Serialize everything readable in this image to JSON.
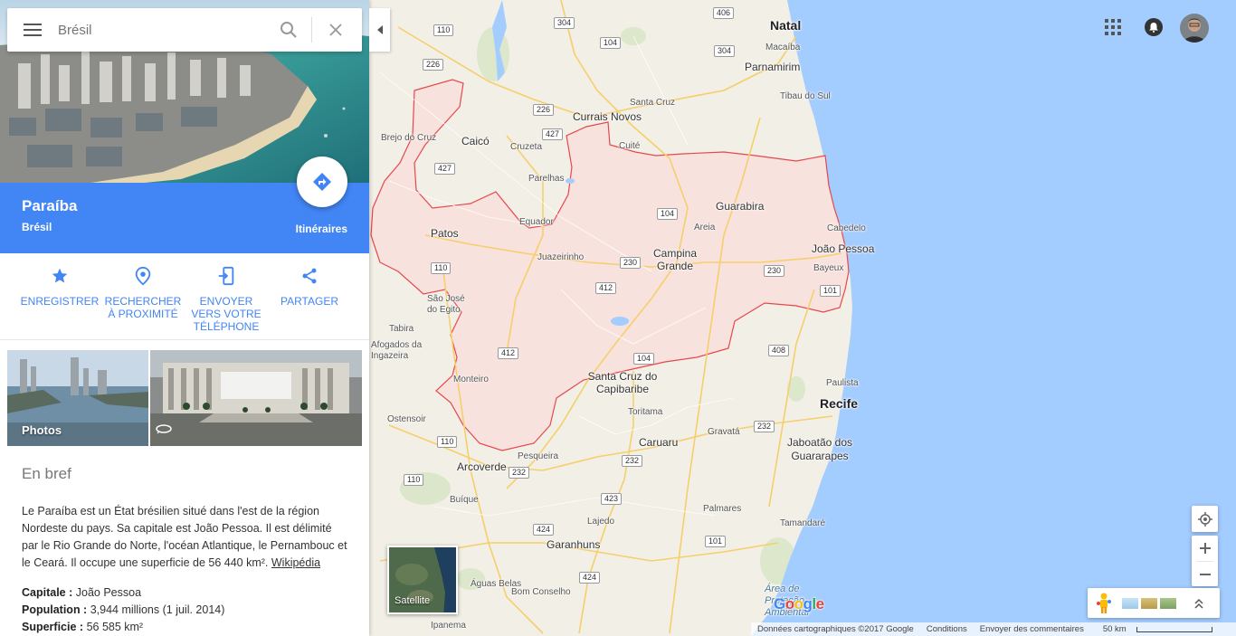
{
  "search": {
    "value": "Brésil",
    "placeholder": "Brésil"
  },
  "place": {
    "title": "Paraíba",
    "subtitle": "Brésil",
    "directions_label": "Itinéraires"
  },
  "actions": [
    {
      "label": "ENREGISTRER",
      "icon": "star-icon"
    },
    {
      "label": "RECHERCHER À PROXIMITÉ",
      "icon": "nearby-pin-icon"
    },
    {
      "label": "ENVOYER VERS VOTRE TÉLÉPHONE",
      "icon": "send-to-phone-icon"
    },
    {
      "label": "PARTAGER",
      "icon": "share-icon"
    }
  ],
  "photos": {
    "label": "Photos"
  },
  "overview": {
    "heading": "En bref",
    "text": "Le Paraíba est un État brésilien situé dans l'est de la région Nordeste du pays. Sa capitale est João Pessoa. Il est délimité par le Rio Grande do Norte, l'océan Atlantique, le Pernambouc et le Ceará. Il occupe une superficie de 56 440 km².",
    "link": "Wikipédia",
    "facts": [
      {
        "label": "Capitale :",
        "value": "João Pessoa"
      },
      {
        "label": "Population :",
        "value": "3,944 millions (1 juil. 2014)"
      },
      {
        "label": "Superficie :",
        "value": "56 585 km²"
      }
    ]
  },
  "map": {
    "cities": [
      {
        "name": "Natal",
        "size": "big"
      },
      {
        "name": "Macaíba",
        "size": "small"
      },
      {
        "name": "Parnamirim",
        "size": "med"
      },
      {
        "name": "Tibau do Sul",
        "size": "small"
      },
      {
        "name": "Santa Cruz",
        "size": "small"
      },
      {
        "name": "Currais Novos",
        "size": "med"
      },
      {
        "name": "Caicó",
        "size": "med"
      },
      {
        "name": "Cruzeta",
        "size": "small"
      },
      {
        "name": "Brejo do Cruz",
        "size": "small"
      },
      {
        "name": "Cuité",
        "size": "small"
      },
      {
        "name": "Parelhas",
        "size": "small"
      },
      {
        "name": "Guarabira",
        "size": "med"
      },
      {
        "name": "Cabedelo",
        "size": "small"
      },
      {
        "name": "João Pessoa",
        "size": "med"
      },
      {
        "name": "Bayeux",
        "size": "small"
      },
      {
        "name": "Equador",
        "size": "small"
      },
      {
        "name": "Areia",
        "size": "small"
      },
      {
        "name": "Patos",
        "size": "med"
      },
      {
        "name": "Juazeirinho",
        "size": "small"
      },
      {
        "name": "Campina Grande",
        "size": "med"
      },
      {
        "name": "São José do Egito",
        "size": "small"
      },
      {
        "name": "Tabira",
        "size": "small"
      },
      {
        "name": "Afogados da Ingazeira",
        "size": "small"
      },
      {
        "name": "Monteiro",
        "size": "small"
      },
      {
        "name": "Santa Cruz do Capibaribe",
        "size": "med"
      },
      {
        "name": "Paulista",
        "size": "small"
      },
      {
        "name": "Recife",
        "size": "big"
      },
      {
        "name": "Ostensoir",
        "size": "small"
      },
      {
        "name": "Toritama",
        "size": "small"
      },
      {
        "name": "Caruaru",
        "size": "med"
      },
      {
        "name": "Gravatá",
        "size": "small"
      },
      {
        "name": "Jaboatão dos Guararapes",
        "size": "med"
      },
      {
        "name": "Arcoverde",
        "size": "med"
      },
      {
        "name": "Pesqueira",
        "size": "small"
      },
      {
        "name": "Buíque",
        "size": "small"
      },
      {
        "name": "Palmares",
        "size": "small"
      },
      {
        "name": "Lajedo",
        "size": "small"
      },
      {
        "name": "Tamandaré",
        "size": "small"
      },
      {
        "name": "Garanhuns",
        "size": "med"
      },
      {
        "name": "Bom Conselho",
        "size": "small"
      },
      {
        "name": "Águas Belas",
        "size": "small"
      },
      {
        "name": "Ipanema",
        "size": "small"
      },
      {
        "name": "Área de Proteção Ambiental",
        "size": "blue"
      }
    ],
    "highways": [
      "304",
      "406",
      "110",
      "104",
      "304",
      "226",
      "226",
      "427",
      "427",
      "104",
      "230",
      "230",
      "412",
      "110",
      "104",
      "101",
      "412",
      "408",
      "110",
      "232",
      "232",
      "232",
      "110",
      "423",
      "424",
      "101",
      "424"
    ],
    "controls": {
      "satellite_label": "Satellite",
      "logo": "Google"
    },
    "footer": {
      "data": "Données cartographiques ©2017 Google",
      "terms": "Conditions",
      "feedback": "Envoyer des commentaires",
      "scale": "50 km"
    }
  },
  "colors": {
    "accent": "#4285f4",
    "region_fill": "#f8e2de",
    "region_border": "#e5484d",
    "ocean": "#a3ccff",
    "land": "#f2efe6"
  }
}
